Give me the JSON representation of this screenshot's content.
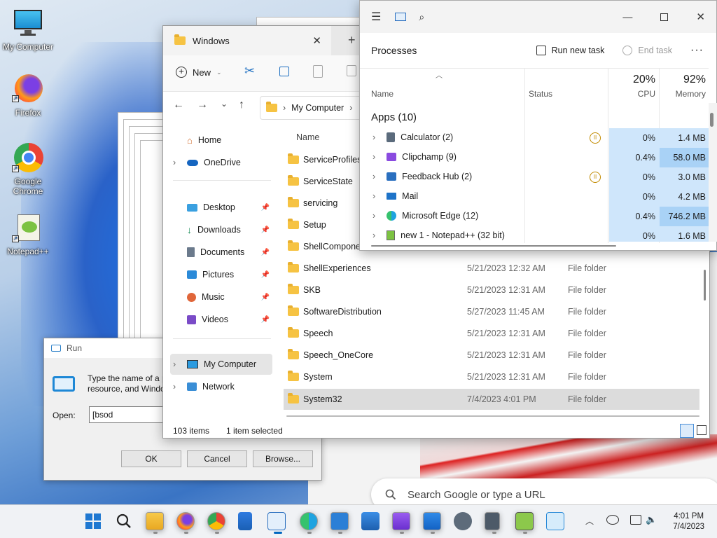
{
  "desktop": {
    "icons": [
      {
        "label": "My Computer"
      },
      {
        "label": "Firefox"
      },
      {
        "label": "Google Chrome"
      },
      {
        "label": "Notepad++"
      }
    ],
    "browser_search_placeholder": "Search Google or type a URL"
  },
  "run_dialog": {
    "title": "Run",
    "description": "Type the name of a p\nresource, and Windo",
    "open_label": "Open:",
    "open_value": "[bsod",
    "ok_label": "OK",
    "cancel_label": "Cancel",
    "browse_label": "Browse..."
  },
  "explorer": {
    "tab_title": "Windows",
    "new_label": "New",
    "breadcrumb": "My Computer",
    "column_name": "Name",
    "sidebar": {
      "home": "Home",
      "onedrive": "OneDrive",
      "desktop": "Desktop",
      "downloads": "Downloads",
      "documents": "Documents",
      "pictures": "Pictures",
      "music": "Music",
      "videos": "Videos",
      "mycomputer": "My Computer",
      "network": "Network"
    },
    "rows": [
      {
        "name": "ServiceProfiles",
        "date": "",
        "type": ""
      },
      {
        "name": "ServiceState",
        "date": "",
        "type": ""
      },
      {
        "name": "servicing",
        "date": "",
        "type": ""
      },
      {
        "name": "Setup",
        "date": "",
        "type": ""
      },
      {
        "name": "ShellComponen",
        "date": "",
        "type": ""
      },
      {
        "name": "ShellExperiences",
        "date": "5/21/2023 12:32 AM",
        "type": "File folder"
      },
      {
        "name": "SKB",
        "date": "5/21/2023 12:31 AM",
        "type": "File folder"
      },
      {
        "name": "SoftwareDistribution",
        "date": "5/27/2023 11:45 AM",
        "type": "File folder"
      },
      {
        "name": "Speech",
        "date": "5/21/2023 12:31 AM",
        "type": "File folder"
      },
      {
        "name": "Speech_OneCore",
        "date": "5/21/2023 12:31 AM",
        "type": "File folder"
      },
      {
        "name": "System",
        "date": "5/21/2023 12:31 AM",
        "type": "File folder"
      },
      {
        "name": "System32",
        "date": "7/4/2023 4:01 PM",
        "type": "File folder"
      }
    ],
    "status_items": "103 items",
    "status_selected": "1 item selected"
  },
  "task_manager": {
    "section_title": "Processes",
    "run_new_task": "Run new task",
    "end_task": "End task",
    "col_name": "Name",
    "col_status": "Status",
    "cpu_pct": "20%",
    "cpu_label": "CPU",
    "mem_pct": "92%",
    "mem_label": "Memory",
    "group": "Apps (10)",
    "processes": [
      {
        "name": "Calculator (2)",
        "cpu": "0%",
        "mem": "1.4 MB"
      },
      {
        "name": "Clipchamp (9)",
        "cpu": "0.4%",
        "mem": "58.0 MB"
      },
      {
        "name": "Feedback Hub (2)",
        "cpu": "0%",
        "mem": "3.0 MB"
      },
      {
        "name": "Mail",
        "cpu": "0%",
        "mem": "4.2 MB"
      },
      {
        "name": "Microsoft Edge (12)",
        "cpu": "0.4%",
        "mem": "746.2 MB"
      },
      {
        "name": "new 1 - Notepad++ (32 bit)",
        "cpu": "0%",
        "mem": "1.6 MB"
      }
    ]
  },
  "taskbar": {
    "time": "4:01 PM",
    "date": "7/4/2023"
  }
}
